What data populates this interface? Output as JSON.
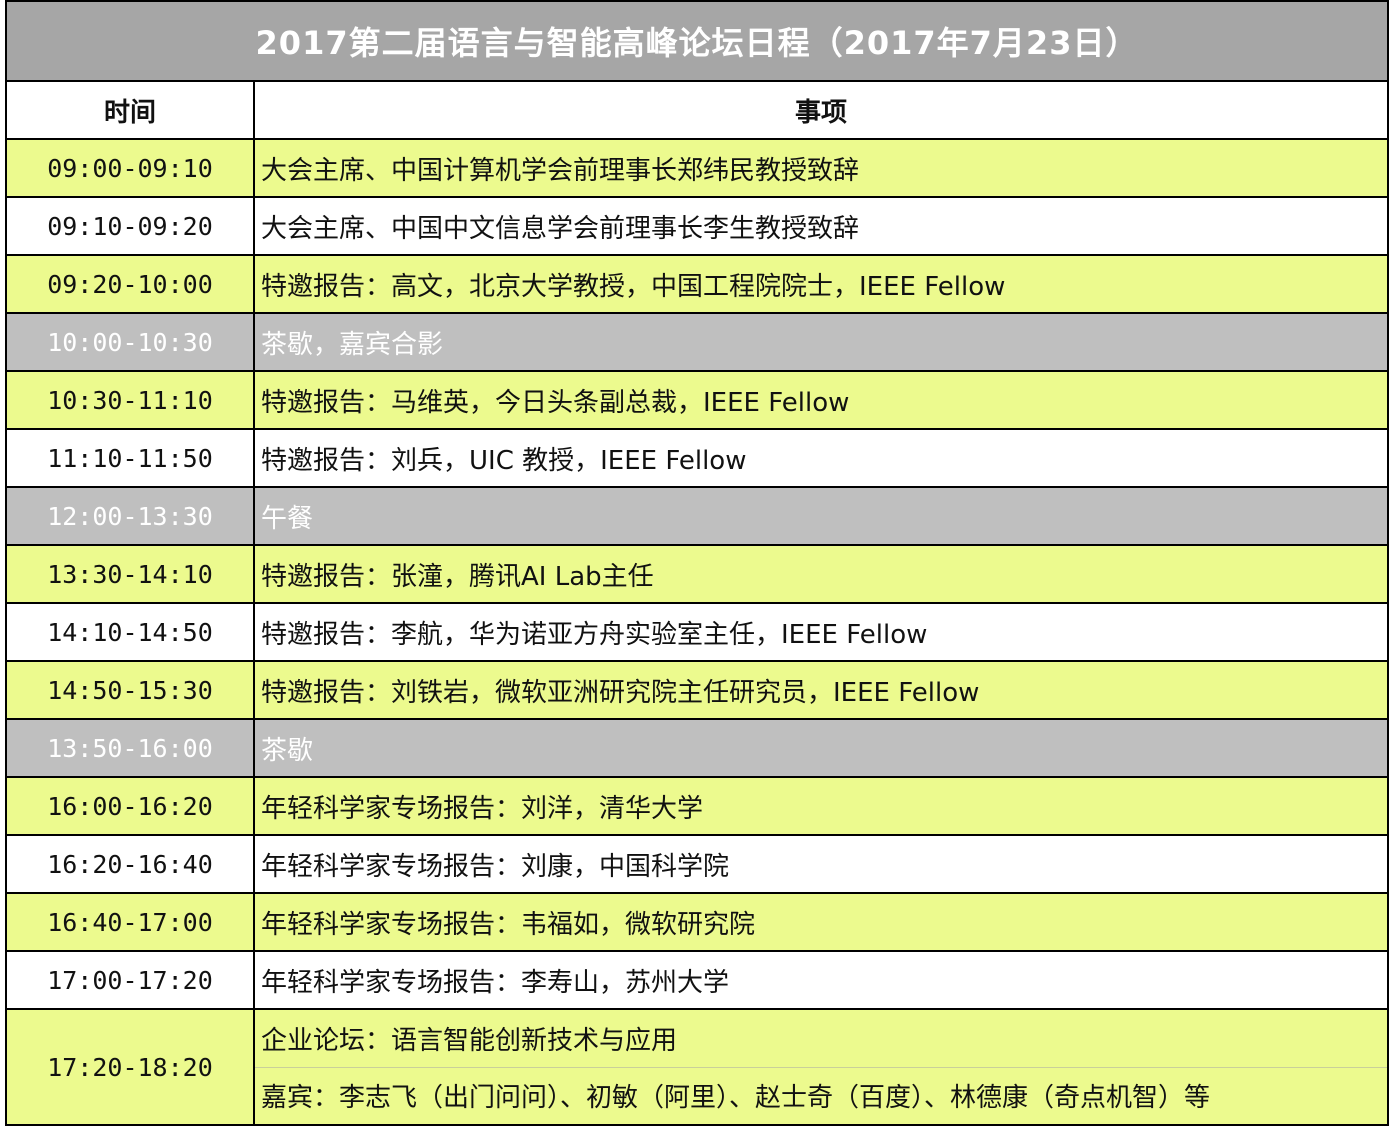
{
  "title": "2017第二届语言与智能高峰论坛日程（2017年7月23日）",
  "header": {
    "time": "时间",
    "item": "事项"
  },
  "rows": [
    {
      "time": "09:00-09:10",
      "item": "大会主席、中国计算机学会前理事长郑纬民教授致辞",
      "style": "yellow"
    },
    {
      "time": "09:10-09:20",
      "item": "大会主席、中国中文信息学会前理事长李生教授致辞",
      "style": "white"
    },
    {
      "time": "09:20-10:00",
      "item": "特邀报告：高文，北京大学教授，中国工程院院士，IEEE Fellow",
      "style": "yellow"
    },
    {
      "time": "10:00-10:30",
      "item": "茶歇，嘉宾合影",
      "style": "gray"
    },
    {
      "time": "10:30-11:10",
      "item": "特邀报告：马维英，今日头条副总裁，IEEE Fellow",
      "style": "yellow"
    },
    {
      "time": "11:10-11:50",
      "item": "特邀报告：刘兵，UIC 教授，IEEE Fellow",
      "style": "white"
    },
    {
      "time": "12:00-13:30",
      "item": "午餐",
      "style": "gray"
    },
    {
      "time": "13:30-14:10",
      "item": "特邀报告：张潼，腾讯AI Lab主任",
      "style": "yellow"
    },
    {
      "time": "14:10-14:50",
      "item": "特邀报告：李航，华为诺亚方舟实验室主任，IEEE Fellow",
      "style": "white"
    },
    {
      "time": "14:50-15:30",
      "item": "特邀报告：刘铁岩，微软亚洲研究院主任研究员，IEEE Fellow",
      "style": "yellow"
    },
    {
      "time": "13:50-16:00",
      "item": "茶歇",
      "style": "gray"
    },
    {
      "time": "16:00-16:20",
      "item": "年轻科学家专场报告：刘洋，清华大学",
      "style": "yellow"
    },
    {
      "time": "16:20-16:40",
      "item": "年轻科学家专场报告：刘康，中国科学院",
      "style": "white"
    },
    {
      "time": "16:40-17:00",
      "item": "年轻科学家专场报告：韦福如，微软研究院",
      "style": "yellow"
    },
    {
      "time": "17:00-17:20",
      "item": "年轻科学家专场报告：李寿山，苏州大学",
      "style": "white"
    }
  ],
  "final_row": {
    "time": "17:20-18:20",
    "line1": "企业论坛：语言智能创新技术与应用",
    "line2": "嘉宾：李志飞（出门问问）、初敏（阿里）、赵士奇（百度）、林德康（奇点机智）等",
    "style": "yellow"
  }
}
